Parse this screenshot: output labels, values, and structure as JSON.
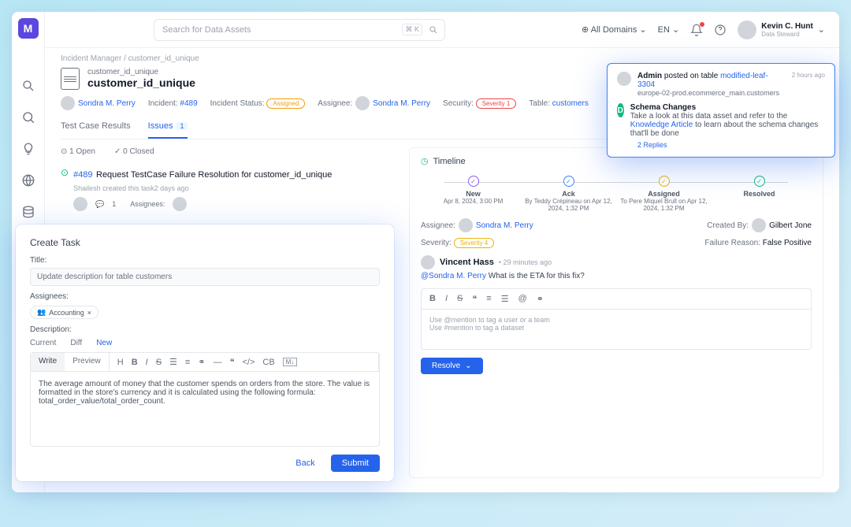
{
  "search": {
    "placeholder": "Search for Data Assets",
    "kbd": "⌘ K"
  },
  "topbar": {
    "domains": "All Domains",
    "lang": "EN",
    "user_name": "Kevin C. Hunt",
    "user_role": "Data Steward"
  },
  "breadcrumb": {
    "a": "Incident Manager",
    "sep": "/",
    "b": "customer_id_unique"
  },
  "header": {
    "eyebrow": "customer_id_unique",
    "title": "customer_id_unique",
    "owner": "Sondra M. Perry",
    "incident_lbl": "Incident:",
    "incident_id": "#489",
    "status_lbl": "Incident Status:",
    "status_val": "Assigned",
    "assignee_lbl": "Assignee:",
    "assignee": "Sondra M. Perry",
    "security_lbl": "Security:",
    "security_val": "Severity 1",
    "table_lbl": "Table:",
    "table_val": "customers"
  },
  "tabs": {
    "results": "Test Case Results",
    "issues": "Issues",
    "issues_count": "1"
  },
  "filters": {
    "open": "1 Open",
    "closed": "0 Closed"
  },
  "issue": {
    "id": "#489",
    "title": "Request TestCase Failure Resolution for customer_id_unique",
    "meta": "Shailesh created this task2 days ago",
    "comments": "1",
    "assignees_lbl": "Assignees:"
  },
  "timeline": {
    "title": "Timeline",
    "steps": [
      {
        "label": "New",
        "sub": "Apr 8, 2024, 3:00 PM"
      },
      {
        "label": "Ack",
        "sub": "By Teddy Crépineau on Apr 12, 2024, 1:32 PM"
      },
      {
        "label": "Assigned",
        "sub": "To Pere Miquel Brull on Apr 12, 2024, 1:32 PM"
      },
      {
        "label": "Resolved",
        "sub": ""
      }
    ],
    "assignee_lbl": "Assignee:",
    "assignee": "Sondra M. Perry",
    "created_lbl": "Created By:",
    "created_by": "Gilbert Jone",
    "severity_lbl": "Severity:",
    "severity_val": "Severity 4",
    "reason_lbl": "Failure Reason:",
    "reason_val": "False Positive"
  },
  "comment": {
    "author": "Vincent Hass",
    "time": "29 minutes ago",
    "mention": "@Sondra M. Perry",
    "text": "What is the ETA for this fix?"
  },
  "editor": {
    "hint1": "Use @mention to tag a user or a team",
    "hint2": "Use #mention to tag a dataset"
  },
  "resolve": "Resolve",
  "modal": {
    "title": "Create Task",
    "title_lbl": "Title:",
    "title_val": "Update description for table customers",
    "assignees_lbl": "Assignees:",
    "chip": "Accounting",
    "desc_lbl": "Description:",
    "subtabs": {
      "current": "Current",
      "diff": "Diff",
      "new": "New"
    },
    "write": "Write",
    "preview": "Preview",
    "body": "The average amount of money that the customer spends on orders from the store. The value is formatted in the store's currency and it is calculated using the following formula: total_order_value/total_order_count.",
    "back": "Back",
    "submit": "Submit"
  },
  "popup": {
    "actor": "Admin",
    "verb": "posted on table",
    "asset": "modified-leaf-3304",
    "path": "europe-02-prod.ecommerce_main.customers",
    "time": "2 hours ago",
    "heading": "Schema Changes",
    "body_a": "Take a look at this data asset and refer to the ",
    "body_link": "Knowledge Article",
    "body_b": " to learn about the schema changes that'll be done",
    "replies": "2 Replies"
  }
}
